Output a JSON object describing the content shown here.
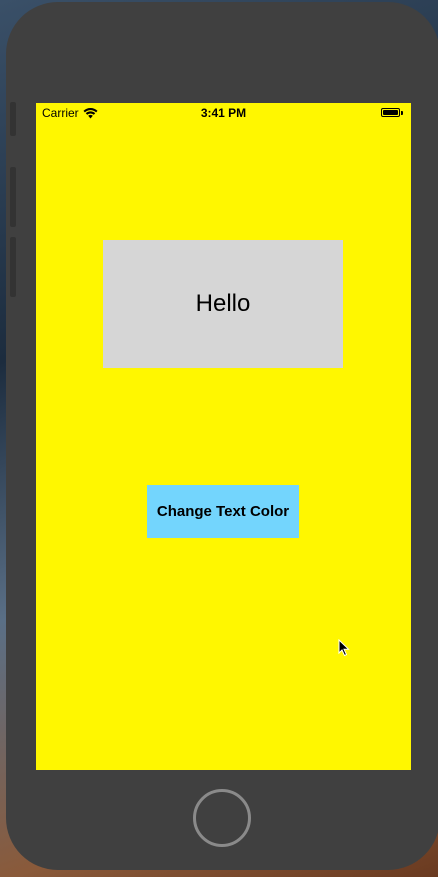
{
  "device": {
    "frame_color": "#404040",
    "screen_background": "#fff700"
  },
  "status_bar": {
    "carrier": "Carrier",
    "time": "3:41 PM",
    "wifi_icon": "wifi-icon",
    "battery_icon": "battery-icon"
  },
  "main": {
    "hello_label": {
      "text": "Hello",
      "background": "#d6d6d6"
    },
    "change_button": {
      "label": "Change Text Color",
      "background": "#73d5fd"
    }
  },
  "home_button_icon": "home-button"
}
